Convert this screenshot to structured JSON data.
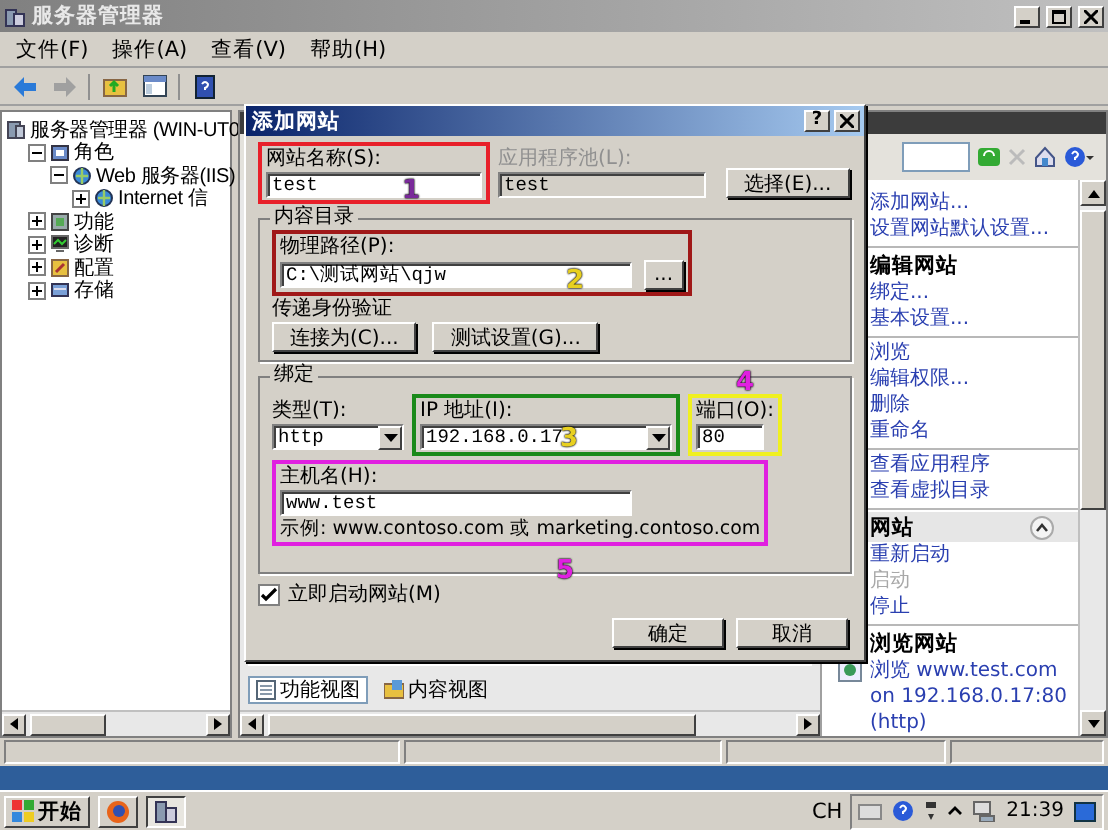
{
  "window": {
    "title": "服务器管理器"
  },
  "menu": [
    "文件(F)",
    "操作(A)",
    "查看(V)",
    "帮助(H)"
  ],
  "tree": [
    {
      "label": "服务器管理器 (WIN-UT0",
      "children": [
        {
          "label": "角色",
          "expanded": true,
          "children": [
            {
              "label": "Web 服务器(IIS)",
              "expanded": true,
              "children": [
                {
                  "label": "Internet 信",
                  "expanded": false
                }
              ]
            }
          ]
        },
        {
          "label": "功能",
          "expanded": false
        },
        {
          "label": "诊断",
          "expanded": false
        },
        {
          "label": "配置",
          "expanded": false
        },
        {
          "label": "存储",
          "expanded": false
        }
      ]
    }
  ],
  "content_tabs": [
    {
      "label": "功能视图",
      "selected": true
    },
    {
      "label": "内容视图",
      "selected": false
    }
  ],
  "action_groups": [
    {
      "items": [
        {
          "kind": "link",
          "label": "添加网站...",
          "disabled": false
        },
        {
          "kind": "link",
          "label": "设置网站默认设置...",
          "disabled": false
        }
      ]
    },
    {
      "title": "编辑网站",
      "collapsible": false,
      "items": [
        {
          "kind": "link",
          "label": "绑定...",
          "disabled": false
        },
        {
          "kind": "link",
          "label": "基本设置...",
          "disabled": false
        }
      ]
    },
    {
      "items": [
        {
          "kind": "link",
          "label": "浏览",
          "disabled": false
        },
        {
          "kind": "link",
          "label": "编辑权限...",
          "disabled": false
        },
        {
          "kind": "link",
          "label": "删除",
          "disabled": false
        },
        {
          "kind": "link",
          "label": "重命名",
          "disabled": false
        }
      ]
    },
    {
      "items": [
        {
          "kind": "link",
          "label": "查看应用程序",
          "disabled": false
        },
        {
          "kind": "link",
          "label": "查看虚拟目录",
          "disabled": false
        }
      ]
    },
    {
      "title": "网站",
      "collapsible": true,
      "items": [
        {
          "kind": "link",
          "label": "重新启动",
          "disabled": false
        },
        {
          "kind": "link",
          "label": "启动",
          "disabled": true
        },
        {
          "kind": "link",
          "label": "停止",
          "disabled": false
        }
      ]
    },
    {
      "title": "浏览网站",
      "collapsible": false,
      "items": [
        {
          "kind": "globe-link",
          "label": "浏览 www.test.com on 192.168.0.17:80 (http)",
          "disabled": false
        }
      ]
    }
  ],
  "dialog": {
    "title": "添加网站",
    "help_button": "?",
    "site_name": {
      "label": "网站名称(S):",
      "value": "test"
    },
    "app_pool": {
      "label": "应用程序池(L):",
      "value": "test",
      "disabled": true
    },
    "select_button": "选择(E)...",
    "content_group": "内容目录",
    "physical_path": {
      "label": "物理路径(P):",
      "value": "C:\\测试网站\\qjw"
    },
    "browse_button": "...",
    "pass_through": "传递身份验证",
    "connect_button": "连接为(C)...",
    "test_button": "测试设置(G)...",
    "binding_group": "绑定",
    "type": {
      "label": "类型(T):",
      "value": "http"
    },
    "ip": {
      "label": "IP 地址(I):",
      "value": "192.168.0.17"
    },
    "port": {
      "label": "端口(O):",
      "value": "80"
    },
    "host": {
      "label": "主机名(H):",
      "value": "www.test"
    },
    "example": "示例: www.contoso.com 或 marketing.contoso.com",
    "start_now": {
      "label": "立即启动网站(M)",
      "checked": true
    },
    "ok_button": "确定",
    "cancel_button": "取消"
  },
  "annotations": [
    {
      "color": "#e8202a",
      "number": {
        "label": "1",
        "color": "#7a2a9a"
      }
    },
    {
      "color": "#a01818",
      "number": {
        "label": "2",
        "color": "#e8d020"
      }
    },
    {
      "color": "#1a8a1a",
      "number": {
        "label": "3",
        "color": "#e8d020"
      }
    },
    {
      "color": "#f0f020",
      "number": {
        "label": "4",
        "color": "#e020e0"
      }
    },
    {
      "color": "#e020e0",
      "number": {
        "label": "5",
        "color": "#e020e0"
      }
    }
  ],
  "taskbar": {
    "start": "开始",
    "language": "CH",
    "clock": "21:39"
  }
}
